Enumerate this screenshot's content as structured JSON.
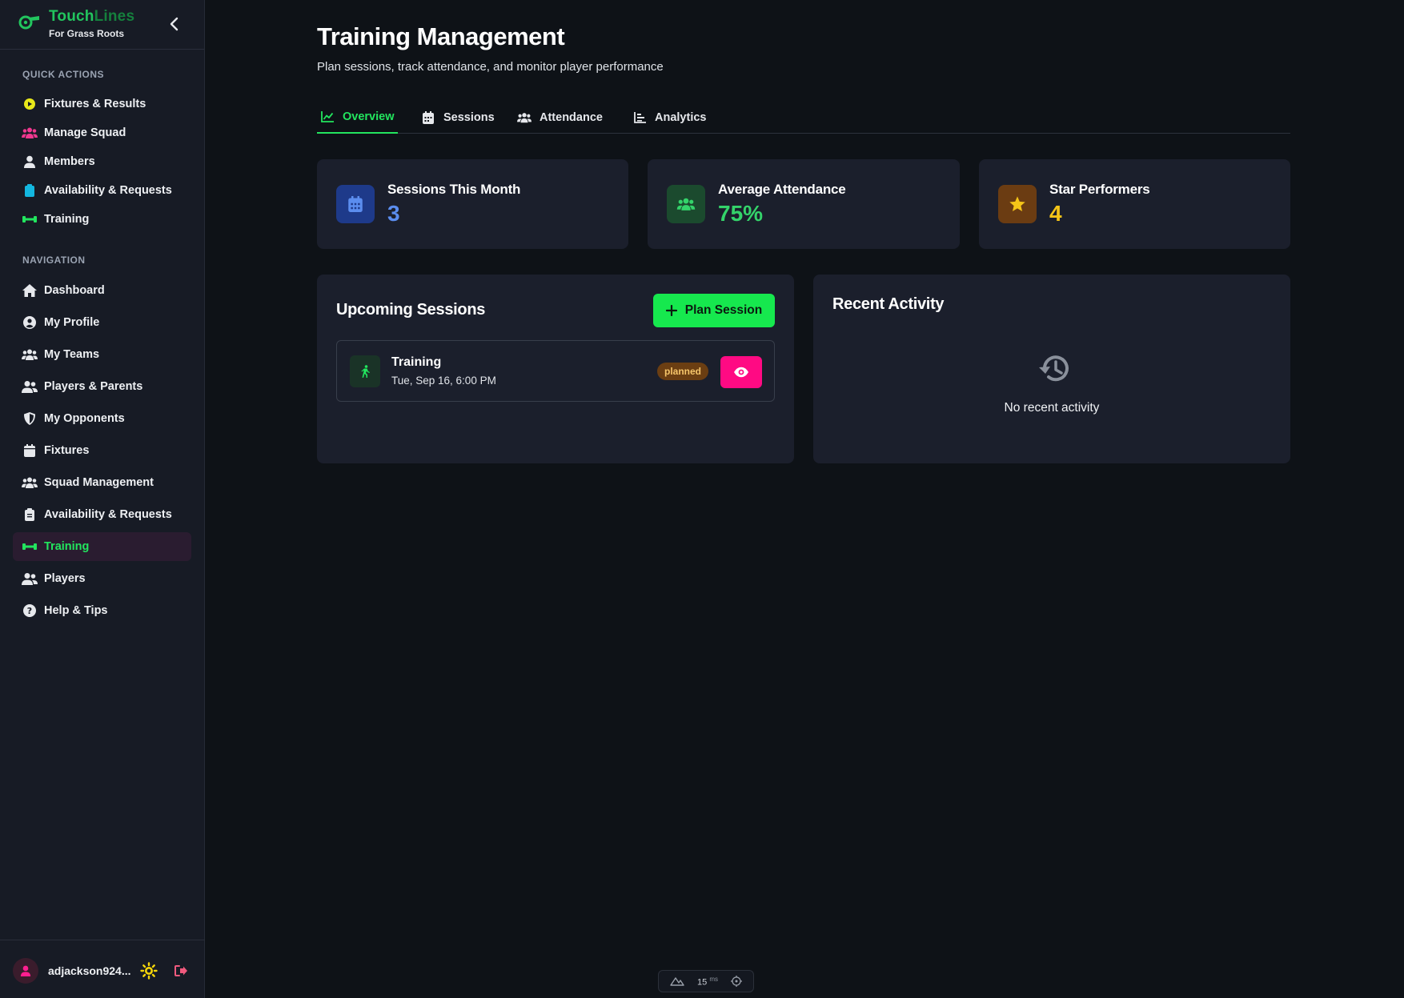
{
  "brand": {
    "name_part1": "Touch",
    "name_part2": "Lines",
    "subtitle": "For Grass Roots"
  },
  "sidebar": {
    "quick_actions_title": "QUICK ACTIONS",
    "quick_actions": [
      {
        "label": "Fixtures & Results",
        "icon": "football-icon"
      },
      {
        "label": "Manage Squad",
        "icon": "users-icon"
      },
      {
        "label": "Members",
        "icon": "user-icon"
      },
      {
        "label": "Availability & Requests",
        "icon": "clipboard-icon"
      },
      {
        "label": "Training",
        "icon": "dumbbell-icon"
      }
    ],
    "navigation_title": "NAVIGATION",
    "navigation": [
      {
        "label": "Dashboard",
        "icon": "home-icon"
      },
      {
        "label": "My Profile",
        "icon": "user-circle-icon"
      },
      {
        "label": "My Teams",
        "icon": "users-icon"
      },
      {
        "label": "Players & Parents",
        "icon": "user-group-icon"
      },
      {
        "label": "My Opponents",
        "icon": "shield-icon"
      },
      {
        "label": "Fixtures",
        "icon": "calendar-icon"
      },
      {
        "label": "Squad Management",
        "icon": "users-icon"
      },
      {
        "label": "Availability & Requests",
        "icon": "clipboard-icon"
      },
      {
        "label": "Training",
        "icon": "dumbbell-icon",
        "active": true
      },
      {
        "label": "Players",
        "icon": "user-group-icon"
      },
      {
        "label": "Help & Tips",
        "icon": "question-icon"
      }
    ],
    "user": {
      "name": "adjackson924..."
    }
  },
  "page": {
    "title": "Training Management",
    "subtitle": "Plan sessions, track attendance, and monitor player performance"
  },
  "tabs": [
    {
      "label": "Overview",
      "icon": "chart-line-icon",
      "active": true
    },
    {
      "label": "Sessions",
      "icon": "calendar-icon"
    },
    {
      "label": "Attendance",
      "icon": "users-icon"
    },
    {
      "label": "Analytics",
      "icon": "chart-bar-icon"
    }
  ],
  "stats": [
    {
      "label": "Sessions This Month",
      "value": "3",
      "color": "#5b8def",
      "bg": "#1e3a8a",
      "icon": "calendar-icon"
    },
    {
      "label": "Average Attendance",
      "value": "75%",
      "color": "#34d36a",
      "bg": "#1b4a2e",
      "icon": "users-icon"
    },
    {
      "label": "Star Performers",
      "value": "4",
      "color": "#f5c518",
      "bg": "#6b3c12",
      "icon": "star-icon"
    }
  ],
  "upcoming": {
    "title": "Upcoming Sessions",
    "plan_button": "Plan Session",
    "sessions": [
      {
        "name": "Training",
        "date": "Tue, Sep 16, 6:00 PM",
        "status": "planned"
      }
    ]
  },
  "activity": {
    "title": "Recent Activity",
    "empty": "No recent activity"
  },
  "perf": {
    "value": "15",
    "unit": "ms"
  },
  "colors": {
    "accent": "#22e55e",
    "primary_button": "#16e84e",
    "view_button": "#ff0a83"
  }
}
